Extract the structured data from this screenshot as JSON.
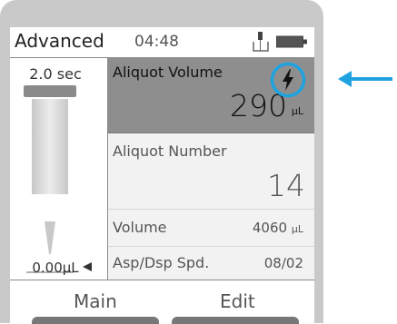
{
  "status_bar": {
    "mode": "Advanced",
    "time": "04:48",
    "usb_icon": "usb-icon",
    "battery_icon": "battery-icon"
  },
  "left_panel": {
    "timer": "2.0 sec",
    "volume": "0.00µL",
    "graphic": "pipette-tip-icon"
  },
  "params": [
    {
      "label": "Aliquot Volume",
      "value": "290",
      "unit": "µL"
    },
    {
      "label": "Aliquot Number",
      "value": "14"
    },
    {
      "label": "Volume",
      "value": "4060",
      "unit": "µL"
    },
    {
      "label": "Asp/Dsp Spd.",
      "value": "08/02"
    }
  ],
  "softkeys": {
    "left": "Main",
    "right": "Edit"
  },
  "icons": {
    "bolt": "lightning-bolt-icon",
    "callout_arrow": "arrow-left-icon"
  },
  "colors": {
    "highlight": "#1fa3e0",
    "selected_row": "#8e8e8e",
    "device_frame": "#c9c9c9"
  }
}
